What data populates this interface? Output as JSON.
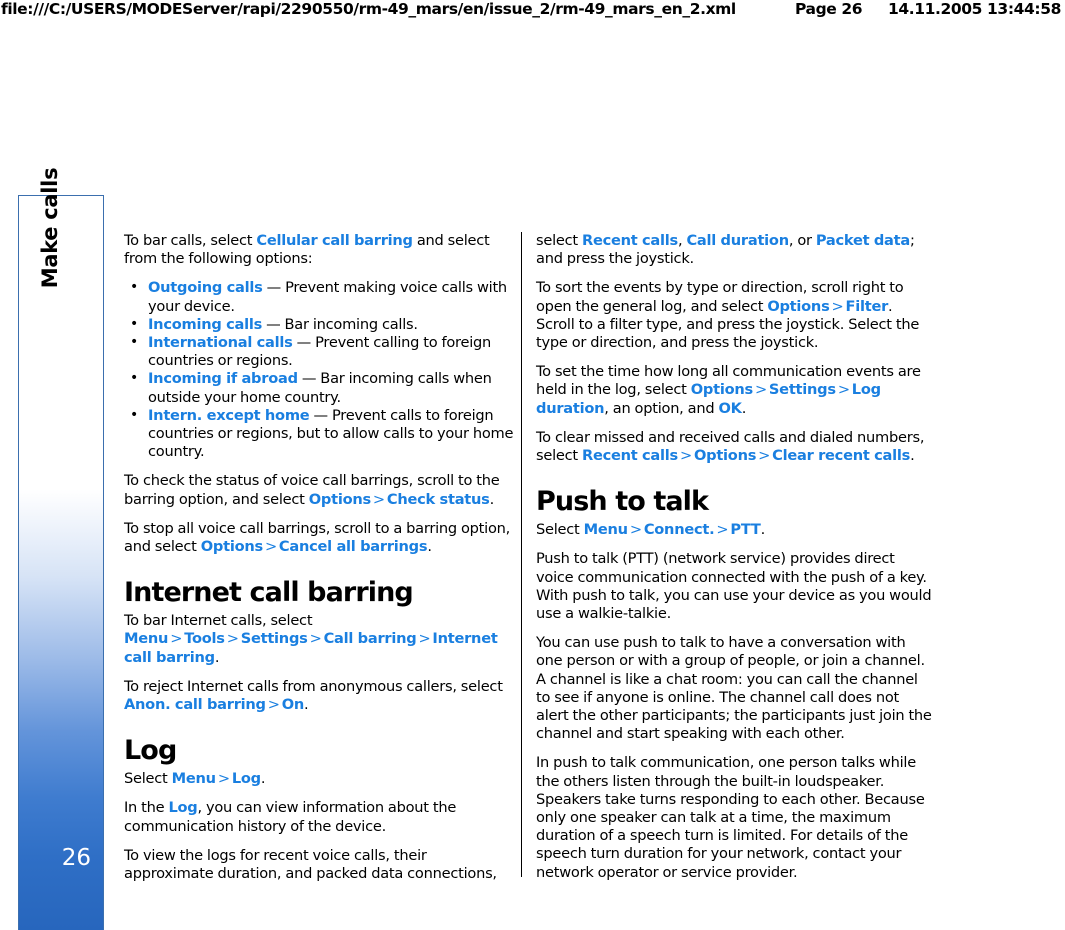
{
  "header": {
    "url": "file:///C:/USERS/MODEServer/rapi/2290550/rm-49_mars/en/issue_2/rm-49_mars_en_2.xml",
    "page": "Page 26",
    "datetime": "14.11.2005 13:44:58"
  },
  "sidebar": {
    "chapter_label": "Make calls",
    "page_number": "26",
    "accent_color": "#2766bd",
    "border_color": "#3b6fae"
  },
  "colors": {
    "link": "#1a7fe0",
    "text": "#000000",
    "background": "#ffffff"
  },
  "left_column": {
    "intro": {
      "before": "To bar calls, select ",
      "link": "Cellular call barring",
      "after": " and select from the following options:"
    },
    "bullets": [
      {
        "term": "Outgoing calls",
        "desc": " — Prevent making voice calls with your device."
      },
      {
        "term": "Incoming calls",
        "desc": " — Bar incoming calls."
      },
      {
        "term": "International calls",
        "desc": " — Prevent calling to foreign countries or regions."
      },
      {
        "term": "Incoming if abroad",
        "desc": " — Bar incoming calls when outside your home country."
      },
      {
        "term": "Intern. except home",
        "desc": " — Prevent calls to foreign countries or regions, but to allow calls to your home country."
      }
    ],
    "check_status": {
      "t1": "To check the status of voice call barrings, scroll to the barring option, and select ",
      "l1": "Options",
      "sep1": ">",
      "l2": "Check status",
      "t2": "."
    },
    "stop_barrings": {
      "t1": "To stop all voice call barrings, scroll to a barring option, and select ",
      "l1": "Options",
      "sep1": ">",
      "l2": "Cancel all barrings",
      "t2": "."
    },
    "internet_call_barring": {
      "heading": "Internet call barring",
      "p1": {
        "t1": "To bar Internet calls, select ",
        "l1": "Menu",
        "sep1": ">",
        "l2": "Tools",
        "sep2": ">",
        "l3": "Settings",
        "sep3": ">",
        "l4": "Call barring",
        "sep4": ">",
        "l5": "Internet call barring",
        "t2": "."
      },
      "p2": {
        "t1": "To reject Internet calls from anonymous callers, select ",
        "l1": "Anon. call barring",
        "sep1": ">",
        "l2": "On",
        "t2": "."
      }
    },
    "log": {
      "heading": "Log",
      "p1": {
        "t1": "Select ",
        "l1": "Menu",
        "sep1": ">",
        "l2": "Log",
        "t2": "."
      },
      "p2": {
        "t1": "In the ",
        "l1": "Log",
        "t2": ", you can view information about the communication history of the device."
      },
      "p3": "To view the logs for recent voice calls, their approximate duration, and packed data connections,"
    }
  },
  "right_column": {
    "cont": {
      "t1": "select ",
      "l1": "Recent calls",
      "t2": ", ",
      "l2": "Call duration",
      "t3": ", or ",
      "l3": "Packet data",
      "t4": "; and press the joystick."
    },
    "sort_events": {
      "t1": "To sort the events by type or direction, scroll right to open the general log, and select ",
      "l1": "Options",
      "sep1": ">",
      "l2": "Filter",
      "t2": ". Scroll to a filter type, and press the joystick. Select the type or direction, and press the joystick."
    },
    "log_duration": {
      "t1": "To set the time how long all communication events are held in the log, select ",
      "l1": "Options",
      "sep1": ">",
      "l2": "Settings",
      "sep2": ">",
      "l3": "Log duration",
      "t2": ", an option, and ",
      "l4": "OK",
      "t3": "."
    },
    "clear_calls": {
      "t1": "To clear missed and received calls and dialed numbers, select ",
      "l1": "Recent calls",
      "sep1": ">",
      "l2": "Options",
      "sep2": ">",
      "l3": "Clear recent calls",
      "t2": "."
    },
    "push_to_talk": {
      "heading": "Push to talk",
      "select": {
        "t1": "Select ",
        "l1": "Menu",
        "sep1": ">",
        "l2": "Connect.",
        "sep2": ">",
        "l3": "PTT",
        "t2": "."
      },
      "p1": "Push to talk (PTT) (network service) provides direct voice communication connected with the push of a key. With push to talk, you can use your device as you would use a walkie-talkie.",
      "p2": "You can use push to talk to have a conversation with one person or with a group of people, or join a channel. A channel is like a chat room: you can call the channel to see if anyone is online. The channel call does not alert the other participants; the participants just join the channel and start speaking with each other.",
      "p3": "In push to talk communication, one person talks while the others listen through the built-in loudspeaker. Speakers take turns responding to each other. Because only one speaker can talk at a time, the maximum duration of a speech turn is limited. For details of the speech turn duration for your network, contact your network operator or service provider."
    }
  }
}
